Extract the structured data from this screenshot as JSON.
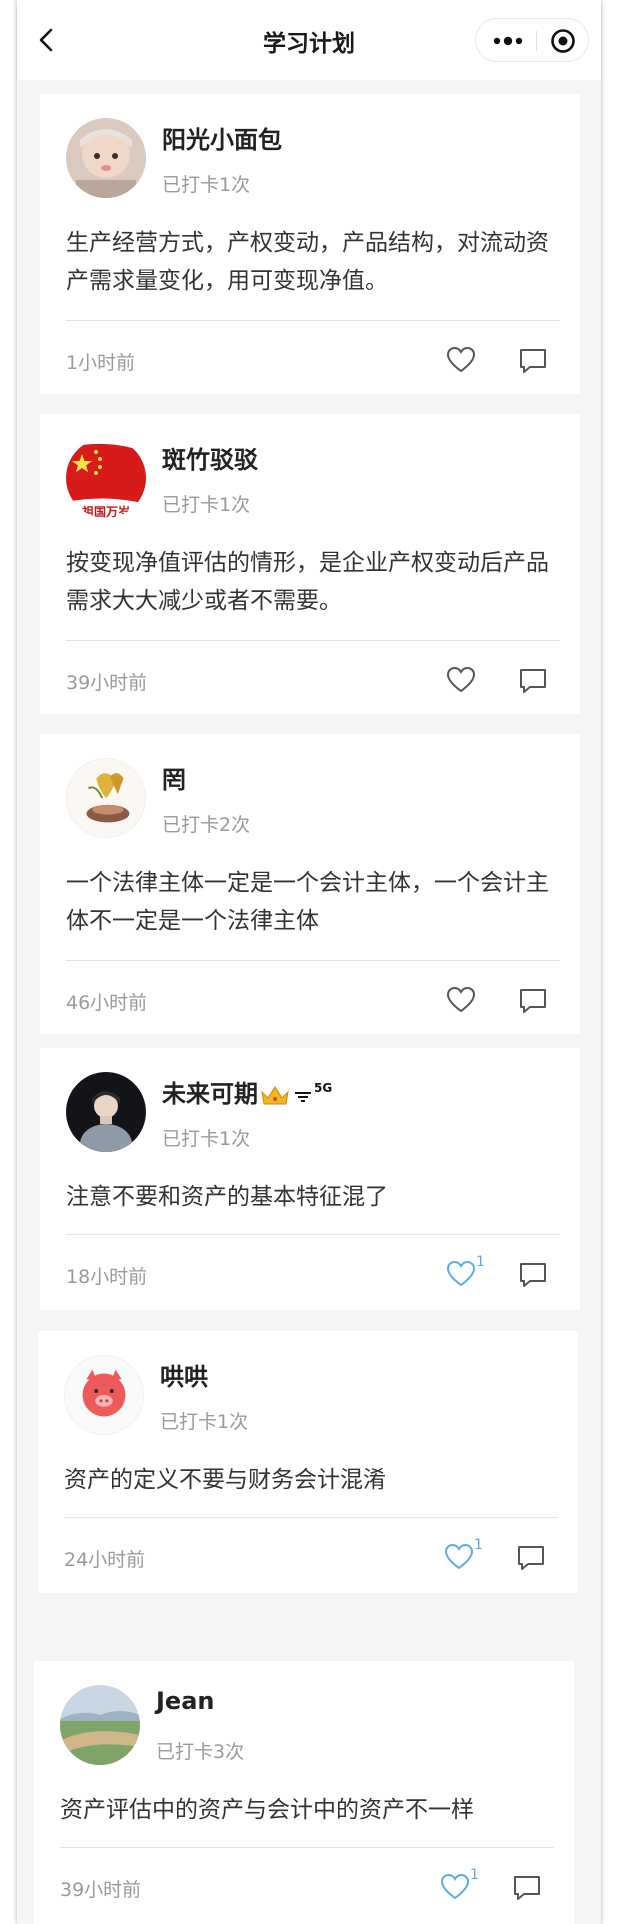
{
  "nav": {
    "title": "学习计划",
    "back_icon": "chevron-left-icon",
    "more_icon": "more-dots-icon",
    "close_icon": "target-circle-icon"
  },
  "posts": [
    {
      "name": "阳光小面包",
      "checkin": "已打卡1次",
      "content": "生产经营方式，产权变动，产品结构，对流动资产需求量变化，用可变现净值。",
      "time": "1小时前",
      "likes": "",
      "liked": false
    },
    {
      "name": "斑竹驳驳",
      "checkin": "已打卡1次",
      "content": "按变现净值评估的情形，是企业产权变动后产品需求大大减少或者不需要。",
      "time": "39小时前",
      "likes": "",
      "liked": false,
      "avatar_text": "祖国万岁"
    },
    {
      "name": "罔",
      "checkin": "已打卡2次",
      "content": "一个法律主体一定是一个会计主体，一个会计主体不一定是一个法律主体",
      "time": "46小时前",
      "likes": "",
      "liked": false
    },
    {
      "name": "未来可期",
      "name_suffix": "5G",
      "checkin": "已打卡1次",
      "content": "注意不要和资产的基本特征混了",
      "time": "18小时前",
      "likes": "1",
      "liked": true
    },
    {
      "name": "哄哄",
      "checkin": "已打卡1次",
      "content": "资产的定义不要与财务会计混淆",
      "time": "24小时前",
      "likes": "1",
      "liked": true
    },
    {
      "name": "Jean",
      "checkin": "已打卡3次",
      "content": "资产评估中的资产与会计中的资产不一样",
      "time": "39小时前",
      "likes": "1",
      "liked": true
    }
  ],
  "colors": {
    "liked": "#5aaee0",
    "icon": "#555555"
  }
}
